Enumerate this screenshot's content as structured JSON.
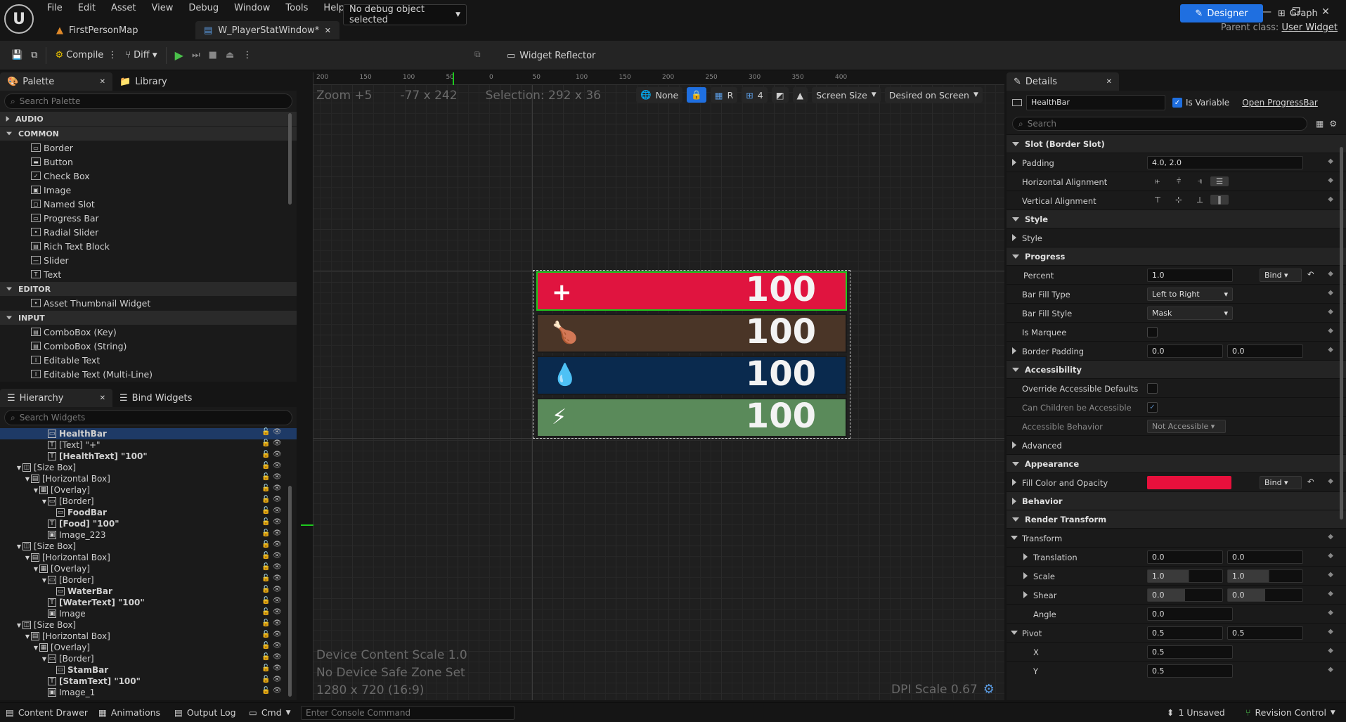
{
  "menu": [
    "File",
    "Edit",
    "Asset",
    "View",
    "Debug",
    "Window",
    "Tools",
    "Help"
  ],
  "tabs": {
    "map": "FirstPersonMap",
    "widget": "W_PlayerStatWindow*"
  },
  "parent_class": {
    "label": "Parent class:",
    "value": "User Widget"
  },
  "toolbar": {
    "compile": "Compile",
    "diff": "Diff",
    "debug_object": "No debug object selected",
    "widget_reflector": "Widget Reflector",
    "designer": "Designer",
    "graph": "Graph"
  },
  "palette": {
    "tab": "Palette",
    "library_tab": "Library",
    "search_placeholder": "Search Palette",
    "categories": [
      {
        "name": "AUDIO",
        "items": []
      },
      {
        "name": "COMMON",
        "items": [
          "Border",
          "Button",
          "Check Box",
          "Image",
          "Named Slot",
          "Progress Bar",
          "Radial Slider",
          "Rich Text Block",
          "Slider",
          "Text"
        ]
      },
      {
        "name": "EDITOR",
        "items": [
          "Asset Thumbnail Widget"
        ]
      },
      {
        "name": "INPUT",
        "items": [
          "ComboBox (Key)",
          "ComboBox (String)",
          "Editable Text",
          "Editable Text (Multi-Line)"
        ]
      }
    ]
  },
  "hierarchy": {
    "tab": "Hierarchy",
    "bind_tab": "Bind Widgets",
    "search_placeholder": "Search Widgets",
    "rows": [
      {
        "text": "HealthBar",
        "indent": 5,
        "bold": true,
        "icon": "pb",
        "sel": true
      },
      {
        "text": "[Text] \"+\"",
        "indent": 5,
        "icon": "T"
      },
      {
        "text": "[HealthText] \"100\"",
        "indent": 5,
        "bold": true,
        "icon": "T"
      },
      {
        "text": "[Size Box]",
        "indent": 2,
        "icon": "sb",
        "exp": true
      },
      {
        "text": "[Horizontal Box]",
        "indent": 3,
        "icon": "hb",
        "exp": true
      },
      {
        "text": "[Overlay]",
        "indent": 4,
        "icon": "ov",
        "exp": true
      },
      {
        "text": "[Border]",
        "indent": 5,
        "icon": "bd",
        "exp": true
      },
      {
        "text": "FoodBar",
        "indent": 6,
        "bold": true,
        "icon": "pb"
      },
      {
        "text": "[Food] \"100\"",
        "indent": 5,
        "bold": true,
        "icon": "T"
      },
      {
        "text": "Image_223",
        "indent": 5,
        "icon": "im"
      },
      {
        "text": "[Size Box]",
        "indent": 2,
        "icon": "sb",
        "exp": true
      },
      {
        "text": "[Horizontal Box]",
        "indent": 3,
        "icon": "hb",
        "exp": true
      },
      {
        "text": "[Overlay]",
        "indent": 4,
        "icon": "ov",
        "exp": true
      },
      {
        "text": "[Border]",
        "indent": 5,
        "icon": "bd",
        "exp": true
      },
      {
        "text": "WaterBar",
        "indent": 6,
        "bold": true,
        "icon": "pb"
      },
      {
        "text": "[WaterText] \"100\"",
        "indent": 5,
        "bold": true,
        "icon": "T"
      },
      {
        "text": "Image",
        "indent": 5,
        "icon": "im"
      },
      {
        "text": "[Size Box]",
        "indent": 2,
        "icon": "sb",
        "exp": true
      },
      {
        "text": "[Horizontal Box]",
        "indent": 3,
        "icon": "hb",
        "exp": true
      },
      {
        "text": "[Overlay]",
        "indent": 4,
        "icon": "ov",
        "exp": true
      },
      {
        "text": "[Border]",
        "indent": 5,
        "icon": "bd",
        "exp": true
      },
      {
        "text": "StamBar",
        "indent": 6,
        "bold": true,
        "icon": "pb"
      },
      {
        "text": "[StamText] \"100\"",
        "indent": 5,
        "bold": true,
        "icon": "T"
      },
      {
        "text": "Image_1",
        "indent": 5,
        "icon": "im"
      }
    ]
  },
  "viewport": {
    "zoom": "Zoom +5",
    "coords": "-77 x 242",
    "selection": "Selection: 292 x 36",
    "none": "None",
    "r": "R",
    "grid": "4",
    "screen_size": "Screen Size",
    "desired": "Desired on Screen",
    "device_content_scale": "Device Content Scale 1.0",
    "safe_zone": "No Device Safe Zone Set",
    "resolution": "1280 x 720 (16:9)",
    "dpi": "DPI Scale 0.67",
    "ruler_top": [
      "200",
      "150",
      "100",
      "50",
      "0",
      "50",
      "100",
      "150",
      "200",
      "250",
      "300",
      "350",
      "400"
    ],
    "bars": [
      {
        "name": "health",
        "icon": "+",
        "value": "100",
        "color": "#e0143f",
        "fill": 1.0
      },
      {
        "name": "food",
        "icon": "🍗",
        "value": "100",
        "color": "#4a3527",
        "fill": 1.0
      },
      {
        "name": "water",
        "icon": "💧",
        "value": "100",
        "color": "#0a2a4e",
        "fill": 1.0
      },
      {
        "name": "stamina",
        "icon": "⚡",
        "value": "100",
        "color": "#5a8a5a",
        "fill": 1.0
      }
    ]
  },
  "details": {
    "tab": "Details",
    "name": "HealthBar",
    "is_variable": "Is Variable",
    "open": "Open ProgressBar",
    "search_placeholder": "Search",
    "slot": "Slot (Border Slot)",
    "padding_label": "Padding",
    "padding": "4.0, 2.0",
    "halign": "Horizontal Alignment",
    "valign": "Vertical Alignment",
    "style_sec": "Style",
    "style": "Style",
    "progress_sec": "Progress",
    "percent_label": "Percent",
    "percent": "1.0",
    "bind": "Bind",
    "fill_type_label": "Bar Fill Type",
    "fill_type": "Left to Right",
    "fill_style_label": "Bar Fill Style",
    "fill_style": "Mask",
    "marquee": "Is Marquee",
    "border_padding": "Border Padding",
    "bp1": "0.0",
    "bp2": "0.0",
    "access_sec": "Accessibility",
    "override": "Override Accessible Defaults",
    "children": "Can Children be Accessible",
    "behavior_label": "Accessible Behavior",
    "behavior": "Not Accessible",
    "advanced": "Advanced",
    "appearance_sec": "Appearance",
    "fill_color": "Fill Color and Opacity",
    "fill_hex": "#e8103c",
    "behavior_sec": "Behavior",
    "render_sec": "Render Transform",
    "transform": "Transform",
    "translation": "Translation",
    "t1": "0.0",
    "t2": "0.0",
    "scale": "Scale",
    "s1": "1.0",
    "s2": "1.0",
    "shear": "Shear",
    "sh1": "0.0",
    "sh2": "0.0",
    "angle": "Angle",
    "a1": "0.0",
    "pivot": "Pivot",
    "p1": "0.5",
    "p2": "0.5",
    "x": "X",
    "xv": "0.5",
    "y": "Y",
    "yv": "0.5"
  },
  "status": {
    "content_drawer": "Content Drawer",
    "animations": "Animations",
    "output_log": "Output Log",
    "cmd": "Cmd",
    "console_placeholder": "Enter Console Command",
    "unsaved": "1 Unsaved",
    "revision": "Revision Control"
  }
}
